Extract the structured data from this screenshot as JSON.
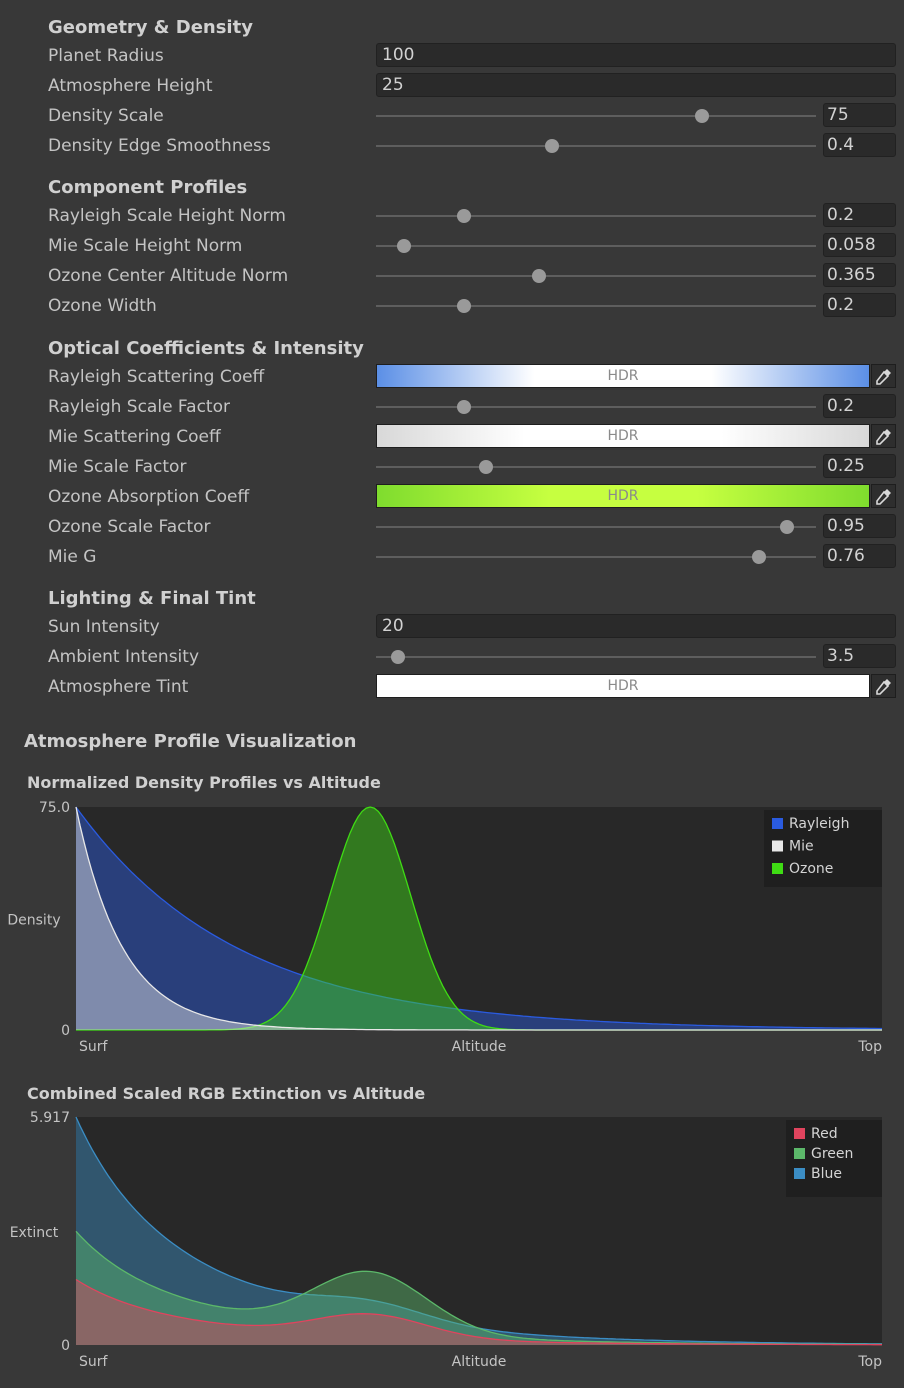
{
  "sections": {
    "geometry": "Geometry & Density",
    "profiles": "Component Profiles",
    "optical": "Optical Coefficients & Intensity",
    "lighting": "Lighting & Final Tint"
  },
  "fields": {
    "planet_radius": {
      "label": "Planet Radius",
      "value": "100"
    },
    "atmosphere_height": {
      "label": "Atmosphere Height",
      "value": "25"
    },
    "density_scale": {
      "label": "Density Scale",
      "value": "75",
      "position": 0.74
    },
    "density_edge": {
      "label": "Density Edge Smoothness",
      "value": "0.4",
      "position": 0.4
    },
    "rayleigh_height": {
      "label": "Rayleigh Scale Height Norm",
      "value": "0.2",
      "position": 0.2
    },
    "mie_height": {
      "label": "Mie Scale Height Norm",
      "value": "0.058",
      "position": 0.064
    },
    "ozone_center": {
      "label": "Ozone Center Altitude Norm",
      "value": "0.365",
      "position": 0.37
    },
    "ozone_width": {
      "label": "Ozone Width",
      "value": "0.2",
      "position": 0.2
    },
    "rayleigh_coeff": {
      "label": "Rayleigh Scattering Coeff",
      "hdr": "HDR"
    },
    "rayleigh_factor": {
      "label": "Rayleigh Scale Factor",
      "value": "0.2",
      "position": 0.2
    },
    "mie_coeff": {
      "label": "Mie Scattering Coeff",
      "hdr": "HDR"
    },
    "mie_factor": {
      "label": "Mie Scale Factor",
      "value": "0.25",
      "position": 0.25
    },
    "ozone_coeff": {
      "label": "Ozone Absorption Coeff",
      "hdr": "HDR"
    },
    "ozone_factor": {
      "label": "Ozone Scale Factor",
      "value": "0.95",
      "position": 0.935
    },
    "mie_g": {
      "label": "Mie G",
      "value": "0.76",
      "position": 0.87
    },
    "sun_intensity": {
      "label": "Sun Intensity",
      "value": "20"
    },
    "ambient_intensity": {
      "label": "Ambient Intensity",
      "value": "3.5",
      "position": 0.05
    },
    "atmosphere_tint": {
      "label": "Atmosphere Tint",
      "hdr": "HDR"
    }
  },
  "colors": {
    "rayleigh_swatch": "#5b8fe6",
    "mie_swatch": "#e6e6e6",
    "ozone_swatch": "#9be23c",
    "tint_swatch": "#ffffff"
  },
  "viz_title": "Atmosphere Profile Visualization",
  "chart_data": [
    {
      "type": "area",
      "title": "Normalized Density Profiles vs Altitude",
      "ylabel": "Density",
      "xlabel": "Altitude",
      "x_start_label": "Surf",
      "x_end_label": "Top",
      "y_max_label": "75.0",
      "y_min_label": "0",
      "ylim": [
        0,
        75
      ],
      "xlim": [
        0,
        1
      ],
      "legend_position": "top-right",
      "series": [
        {
          "name": "Rayleigh",
          "color": "#2a5be0",
          "kind": "exp",
          "peak": 75,
          "scale": 0.2
        },
        {
          "name": "Mie",
          "color": "#e8e8e8",
          "kind": "exp",
          "peak": 75,
          "scale": 0.058
        },
        {
          "name": "Ozone",
          "color": "#3fdc14",
          "kind": "gauss",
          "peak": 75,
          "center": 0.365,
          "width": 0.2
        }
      ]
    },
    {
      "type": "area",
      "title": "Combined Scaled RGB Extinction vs Altitude",
      "ylabel": "Extinct",
      "xlabel": "Altitude",
      "x_start_label": "Surf",
      "x_end_label": "Top",
      "y_max_label": "5.917",
      "y_min_label": "0",
      "ylim": [
        0,
        5.917
      ],
      "xlim": [
        0,
        1
      ],
      "legend_position": "top-right",
      "series": [
        {
          "name": "Red",
          "color": "#e0445e",
          "surface": 1.7,
          "ozone_peak": 0.6
        },
        {
          "name": "Green",
          "color": "#5cb86a",
          "surface": 2.95,
          "ozone_peak": 1.55
        },
        {
          "name": "Blue",
          "color": "#3b8dc4",
          "surface": 5.917,
          "ozone_peak": 0.45
        }
      ]
    }
  ]
}
